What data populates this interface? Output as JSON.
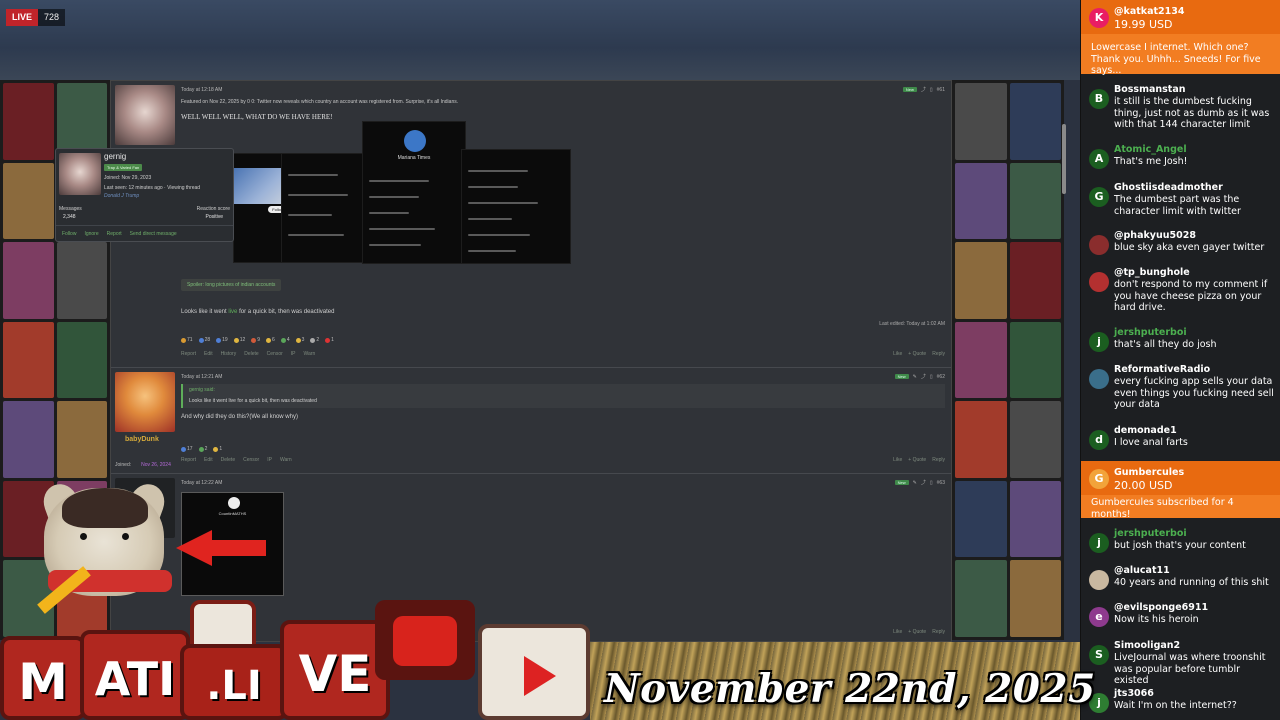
{
  "stream": {
    "live_label": "LIVE",
    "viewer_count": "728",
    "date_banner": "November 22nd, 2025"
  },
  "post1": {
    "timestamp": "Today at 12:18 AM",
    "new_label": "New",
    "post_number": "#61",
    "featured": "Featured on Nov 22, 2025 by 0 0: Twitter now reveals which country an account was registered from. Surprise, it's all Indians.",
    "title": "WELL WELL WELL, WHAT DO WE HAVE HERE!",
    "screenshot_name": "Mariana Times",
    "follow": "Follow",
    "spoiler": "Spoiler: long pictures of indian accounts",
    "content_pre": "Looks like it went",
    "content_link": "live",
    "content_post": "for a quick bit, then was deactivated",
    "edited": "Last edited: Today at 1:02 AM",
    "reactions": [
      {
        "count": "71",
        "color": "#d99a32"
      },
      {
        "count": "28",
        "color": "#4f7fd6"
      },
      {
        "count": "19",
        "color": "#4f7fd6"
      },
      {
        "count": "12",
        "color": "#e0b640"
      },
      {
        "count": "9",
        "color": "#d15a3a"
      },
      {
        "count": "6",
        "color": "#e0b640"
      },
      {
        "count": "4",
        "color": "#5aa65a"
      },
      {
        "count": "3",
        "color": "#e0b640"
      },
      {
        "count": "2",
        "color": "#aaaaaa"
      },
      {
        "count": "1",
        "color": "#d33"
      }
    ],
    "actions": [
      "Report",
      "Edit",
      "History",
      "Delete",
      "Censor",
      "IP",
      "Warn"
    ],
    "actions_right": [
      "Like",
      "+ Quote",
      "Reply"
    ]
  },
  "user_card": {
    "name": "gernig",
    "title": "Trap & Varied Fan",
    "joined": "Joined: Nov 29, 2023",
    "last_seen": "Last seen: 12 minutes ago · Viewing thread",
    "extra": "Donald J Trump",
    "messages_label": "Messages",
    "messages_value": "2,348",
    "reaction_label": "Reaction score",
    "reaction_value": "Positive",
    "actions": [
      "Follow",
      "Ignore",
      "Report",
      "Send direct message"
    ]
  },
  "post2": {
    "timestamp": "Today at 12:21 AM",
    "new_label": "New",
    "post_number": "#62",
    "quote_who": "gernig said: ",
    "quote_text": "Looks like it went live for a quick bit, then was deactivated",
    "reply": "And why did they do this?(We all know why)",
    "user_name": "babyDunk",
    "joined_label": "Joined:",
    "joined_value": "Nov 26, 2024",
    "reactions": [
      {
        "count": "17",
        "color": "#4f7fd6"
      },
      {
        "count": "2",
        "color": "#5aa65a"
      },
      {
        "count": "1",
        "color": "#e0b640"
      }
    ],
    "actions": [
      "Report",
      "Edit",
      "Delete",
      "Censor",
      "IP",
      "Warn"
    ],
    "actions_right": [
      "Like",
      "+ Quote",
      "Reply"
    ]
  },
  "post3": {
    "timestamp": "Today at 12:22 AM",
    "new_label": "New",
    "post_number": "#63",
    "embed_name": "CountInMATHS",
    "actions_right": [
      "Like",
      "+ Quote",
      "Reply"
    ]
  },
  "chat": {
    "donations": [
      {
        "avatar_letter": "K",
        "avatar_color": "#e91e63",
        "name": "@katkat2134",
        "amount": "19.99 USD",
        "text": "Lowercase I internet. Which one? Thank you. Uhhh... Sneeds! For five says..."
      },
      {
        "avatar_letter": "G",
        "avatar_color": "#f2a33a",
        "name": "Gumbercules",
        "amount": "20.00 USD",
        "text": "Gumbercules subscribed for 4 months!"
      }
    ],
    "messages": [
      {
        "avatar": "B",
        "avatar_color": "#1b5e20",
        "name": "Bossmanstan",
        "name_color": "#ffffff",
        "text": "it still is the dumbest fucking thing, just not as dumb as it was with that 144 character limit"
      },
      {
        "avatar": "A",
        "avatar_color": "#1b5e20",
        "name": "Atomic_Angel",
        "name_color": "#4caf50",
        "text": "That's me Josh!"
      },
      {
        "avatar": "G",
        "avatar_color": "#1b5e20",
        "name": "Ghostiisdeadmother",
        "name_color": "#ffffff",
        "text": "The dumbest part was the character limit with twitter"
      },
      {
        "avatar": "",
        "avatar_color": "#8a2d2d",
        "name": "@phakyuu5028",
        "name_color": "#ffffff",
        "text": "blue sky aka even gayer twitter"
      },
      {
        "avatar": "",
        "avatar_color": "#b33030",
        "name": "@tp_bunghole",
        "name_color": "#ffffff",
        "text": "don't respond to my comment if you have cheese pizza on your hard drive."
      },
      {
        "avatar": "j",
        "avatar_color": "#1b5e20",
        "name": "jershputerboi",
        "name_color": "#4caf50",
        "text": "that's all they do josh"
      },
      {
        "avatar": "",
        "avatar_color": "#3a6e8a",
        "name": "ReformativeRadio",
        "name_color": "#ffffff",
        "text": "every fucking app sells your data even things you fucking need sell your data"
      },
      {
        "avatar": "d",
        "avatar_color": "#1b5e20",
        "name": "demonade1",
        "name_color": "#ffffff",
        "text": "I love anal farts"
      },
      {
        "avatar": "j",
        "avatar_color": "#1b5e20",
        "name": "jershputerboi",
        "name_color": "#4caf50",
        "text": "but josh that's your content"
      },
      {
        "avatar": "",
        "avatar_color": "#c9b8a0",
        "name": "@alucat11",
        "name_color": "#ffffff",
        "text": "40 years and running of this shit"
      },
      {
        "avatar": "e",
        "avatar_color": "#8e3a8e",
        "name": "@evilsponge6911",
        "name_color": "#ffffff",
        "text": "Now its his heroin"
      },
      {
        "avatar": "S",
        "avatar_color": "#1b5e20",
        "name": "Simooligan2",
        "name_color": "#ffffff",
        "text": "LiveJournal was where troonshit was popular before tumblr existed"
      },
      {
        "avatar": "j",
        "avatar_color": "#2e7d32",
        "name": "jts3066",
        "name_color": "#ffffff",
        "text": "Wait I'm on the internet??"
      }
    ]
  },
  "overlay": {
    "letters": [
      "M",
      "ATI",
      ".LI",
      "VE"
    ]
  }
}
